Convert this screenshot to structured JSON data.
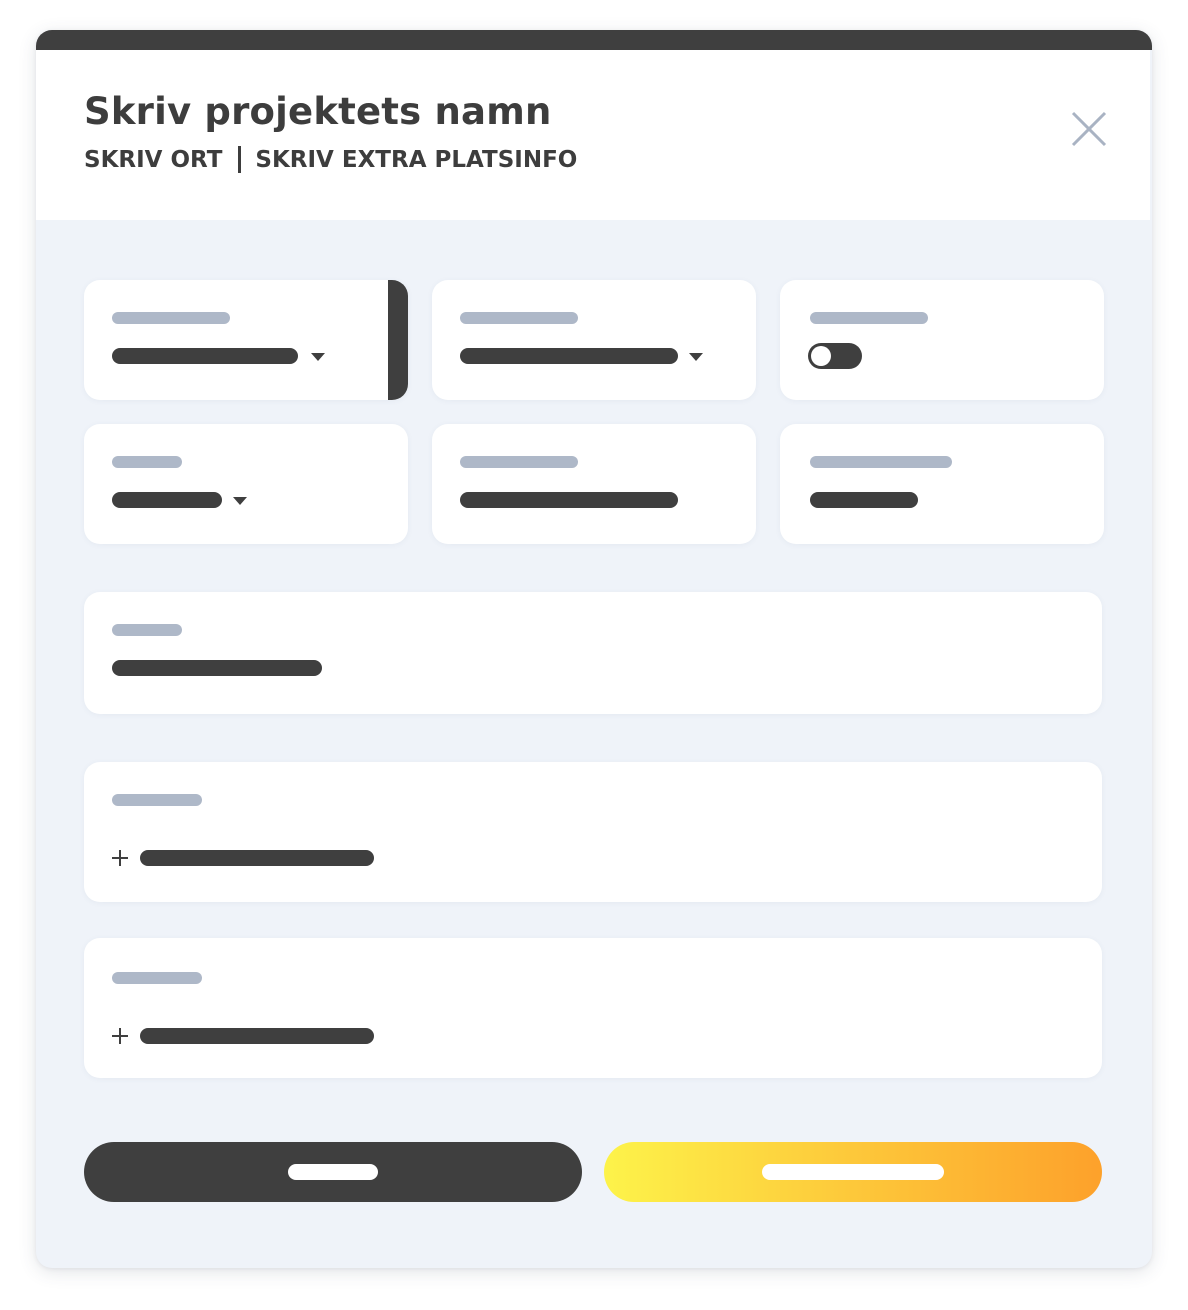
{
  "header": {
    "title": "Skriv projektets namn",
    "location": "SKRIV ORT",
    "extra_location": "SKRIV EXTRA PLATSINFO"
  },
  "icons": {
    "close": "close-icon",
    "dropdown": "caret-down-icon",
    "add": "plus-icon"
  },
  "fields": {
    "toggle_state": "off"
  },
  "colors": {
    "accent_dark": "#3f3f3f",
    "placeholder_label": "#aeb8c8",
    "background": "#eff3f9",
    "primary_gradient_start": "#fdf34a",
    "primary_gradient_end": "#fda12b"
  }
}
